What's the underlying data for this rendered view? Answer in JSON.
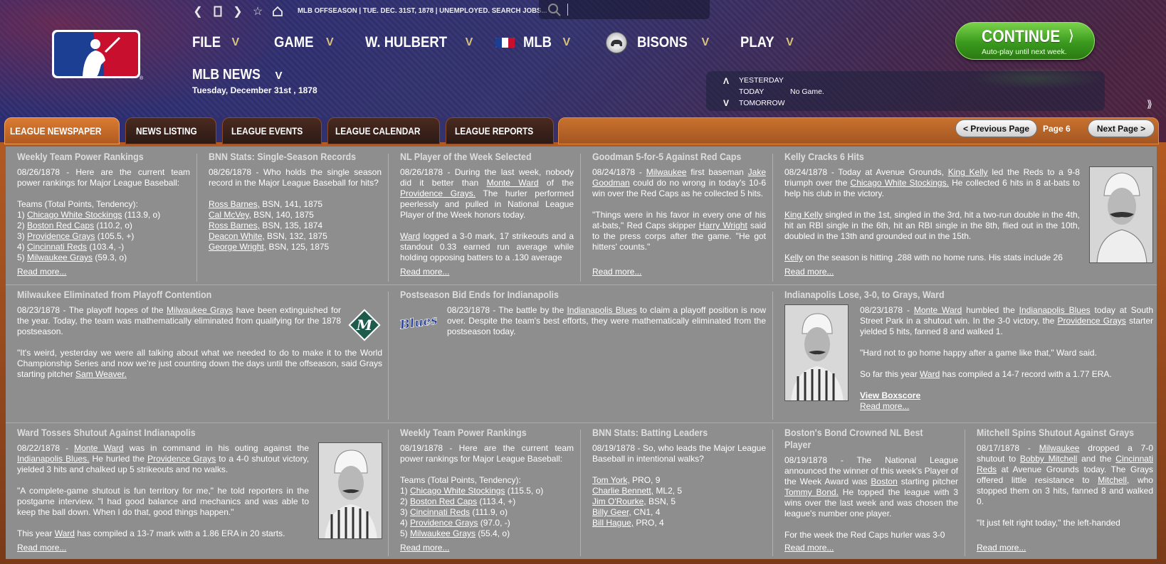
{
  "topbar": {
    "status": "MLB OFFSEASON  |  TUE. DEC. 31ST, 1878  |  UNEMPLOYED. SEARCH JOBS...",
    "search_placeholder": ""
  },
  "menu": {
    "file": "FILE",
    "game": "GAME",
    "manager": "W. HULBERT",
    "mlb": "MLB",
    "team": "BISONS",
    "play": "PLAY"
  },
  "page": {
    "title": "MLB NEWS",
    "date": "Tuesday, December 31st , 1878"
  },
  "continue": {
    "label": "CONTINUE",
    "sub": "Auto-play until next week."
  },
  "days": {
    "yesterday": "YESTERDAY",
    "today": "TODAY",
    "tomorrow": "TOMORROW",
    "today_game": "No Game."
  },
  "tabs": [
    "LEAGUE NEWSPAPER",
    "NEWS LISTING",
    "LEAGUE EVENTS",
    "LEAGUE CALENDAR",
    "LEAGUE REPORTS"
  ],
  "pager": {
    "prev": "< Previous Page",
    "page": "Page 6",
    "next": "Next Page >"
  },
  "read_more": "Read more...",
  "articles": {
    "a1": {
      "title": "Weekly Team Power Rankings",
      "intro": "08/26/1878 - Here are the current team power rankings for Major League Baseball:",
      "hdr": "Teams (Total Points, Tendency):",
      "rows": [
        {
          "n": "1) ",
          "team": "Chicago White Stockings",
          "v": " (113.9, o)"
        },
        {
          "n": "2) ",
          "team": "Boston Red Caps",
          "v": " (110.2, o)"
        },
        {
          "n": "3) ",
          "team": "Providence Grays",
          "v": " (105.5, +)"
        },
        {
          "n": "4) ",
          "team": "Cincinnati Reds",
          "v": " (103.4, -)"
        },
        {
          "n": "5) ",
          "team": "Milwaukee Grays",
          "v": " (59.3, o)"
        }
      ]
    },
    "a2": {
      "title": "BNN Stats: Single-Season Records",
      "intro": "08/26/1878 - Who holds the single season record in the Major League Baseball for hits?",
      "rows": [
        {
          "p": "Ross Barnes,",
          "v": " BSN,  141, 1875"
        },
        {
          "p": "Cal McVey,",
          "v": " BSN,  140, 1875"
        },
        {
          "p": "Ross Barnes,",
          "v": " BSN,  135, 1874"
        },
        {
          "p": "Deacon White,",
          "v": " BSN,  132, 1875"
        },
        {
          "p": "George Wright,",
          "v": " BSN,  125, 1875"
        }
      ]
    },
    "a3": {
      "title": "NL Player of the Week Selected",
      "p1a": "08/26/1878 - During the last week, nobody did it better than ",
      "l1": "Monte Ward",
      "p1b": " of the ",
      "l2": "Providence Grays.",
      "p1c": " The hurler performed peerlessly and pulled in National League Player of the Week honors today.",
      "l3": "Ward",
      "p2": " logged a 3-0 mark, 17 strikeouts and a standout 0.33 earned run average while holding opposing batters to a .130 average"
    },
    "a4": {
      "title": "Goodman 5-for-5 Against Red Caps",
      "p1a": "08/24/1878 - ",
      "l1": "Milwaukee",
      "p1b": " first baseman ",
      "l2": "Jake Goodman",
      "p1c": " could do no wrong in today's 10-6 win over the Red Caps as he collected 5 hits.",
      "p2a": "\"Things were in his favor in every one of his at-bats,\" Red Caps skipper ",
      "l3": "Harry Wright",
      "p2b": " said to the press corps after the game. \"He got hitters' counts.\""
    },
    "a5": {
      "title": "Kelly Cracks 6 Hits",
      "p1a": "08/24/1878 - Today at Avenue Grounds, ",
      "l1": "King Kelly",
      "p1b": " led the Reds to a 9-8 triumph over the ",
      "l2": "Chicago White Stockings.",
      "p1c": " He collected 6 hits in 8 at-bats to help his club in the victory.",
      "l3": "King Kelly",
      "p2": " singled in the 1st, singled in the 3rd, hit a two-run double in the 4th, hit an RBI single in the 6th, hit an RBI single in the 8th, flied out in the 10th, doubled in the 13th and grounded out in the 15th.",
      "l4": "Kelly",
      "p3": " on the season is hitting .288 with no home runs. His stats include 26"
    },
    "a6": {
      "title": "Milwaukee Eliminated from Playoff Contention",
      "p1a": "08/23/1878 - The playoff hopes of the ",
      "l1": "Milwaukee Grays",
      "p1b": " have been extinguished for the year. Today, the team was mathematically eliminated from qualifying for the 1878 postseason.",
      "p2a": "\"It's weird, yesterday we were all talking about what we needed to do to make it to the World Championship Series and now we're just counting down the days until the offseason, said Grays starting pitcher ",
      "l2": "Sam Weaver.",
      "logo": "M"
    },
    "a7": {
      "title": "Postseason Bid Ends for Indianapolis",
      "p1a": "08/23/1878 - The battle by the ",
      "l1": "Indianapolis Blues",
      "p1b": " to claim a playoff position is now over. Despite the team's best efforts, they were mathematically eliminated from the postseason today.",
      "logo": "Blues"
    },
    "a8": {
      "title": "Indianapolis Lose, 3-0, to Grays, Ward",
      "p1a": "08/23/1878 - ",
      "l1": "Monte Ward",
      "p1b": " humbled the ",
      "l2": "Indianapolis Blues",
      "p1c": " today at South Street Park in a shutout win. In the 3-0 victory, the ",
      "l3": "Providence Grays",
      "p1d": " starter yielded 5 hits, fanned 8 and walked 1.",
      "p2": "\"Hard not to go home happy after a game like that,\" Ward said.",
      "p3a": "So far this year ",
      "l4": "Ward",
      "p3b": " has compiled a 14-7 record with a 1.77 ERA.",
      "box": "View Boxscore"
    },
    "a9": {
      "title": "Ward Tosses Shutout Against Indianapolis",
      "p1a": "08/22/1878 - ",
      "l1": "Monte Ward",
      "p1b": " was in command in his outing against the ",
      "l2": "Indianapolis Blues.",
      "p1c": " He hurled the ",
      "l3": "Providence Grays",
      "p1d": " to a 4-0 shutout victory, yielded 3 hits and chalked up 5 strikeouts and no walks.",
      "p2": "\"A complete-game shutout is fun territory for me,\" he told reporters in the postgame interview. \"I had good balance and mechanics and was able to keep the ball down. When I do that, good things happen.\"",
      "p3a": "This year ",
      "l4": "Ward",
      "p3b": " has compiled a 13-7 mark with a 1.86 ERA in 20 starts."
    },
    "a10": {
      "title": "Weekly Team Power Rankings",
      "intro": "08/19/1878 - Here are the current team power rankings for Major League Baseball:",
      "hdr": "Teams (Total Points, Tendency):",
      "rows": [
        {
          "n": "1) ",
          "team": "Chicago White Stockings",
          "v": " (115.5, o)"
        },
        {
          "n": "2) ",
          "team": "Boston Red Caps",
          "v": " (113.4, +)"
        },
        {
          "n": "3) ",
          "team": "Cincinnati Reds",
          "v": " (111.9, o)"
        },
        {
          "n": "4) ",
          "team": "Providence Grays",
          "v": " (97.0, -)"
        },
        {
          "n": "5) ",
          "team": "Milwaukee Grays",
          "v": " (55.4, o)"
        }
      ]
    },
    "a11": {
      "title": "BNN Stats: Batting Leaders",
      "intro": "08/19/1878 - So, who leads the Major League Baseball in intentional walks?",
      "rows": [
        {
          "p": "Tom York,",
          "v": " PRO,  9"
        },
        {
          "p": "Charlie Bennett,",
          "v": " ML2,  5"
        },
        {
          "p": "Jim O'Rourke,",
          "v": " BSN,  5"
        },
        {
          "p": "Billy Geer,",
          "v": " CN1,  4"
        },
        {
          "p": "Bill Hague,",
          "v": " PRO,  4"
        }
      ]
    },
    "a12": {
      "title": "Boston's Bond Crowned NL Best Player",
      "p1a": "08/19/1878 - The National League announced the winner of this week's Player of the Week Award was ",
      "l1": "Boston",
      "p1b": " starting pitcher ",
      "l2": "Tommy Bond.",
      "p1c": " He topped the league with 3 wins over the last week and was chosen the league's number one player.",
      "p2": "For the week the Red Caps hurler was 3-0"
    },
    "a13": {
      "title": "Mitchell Spins Shutout Against Grays",
      "p1a": "08/17/1878 - ",
      "l1": "Milwaukee",
      "p1b": " dropped a 7-0 shutout to ",
      "l2": "Bobby Mitchell",
      "p1c": " and the ",
      "l3": "Cincinnati Reds",
      "p1d": " at Avenue Grounds today. The Grays offered little resistance to ",
      "l4": "Mitchell,",
      "p1e": " who stopped them on 3 hits, fanned 8 and walked 0.",
      "p2": "\"It just felt right today,\" the left-handed"
    }
  }
}
